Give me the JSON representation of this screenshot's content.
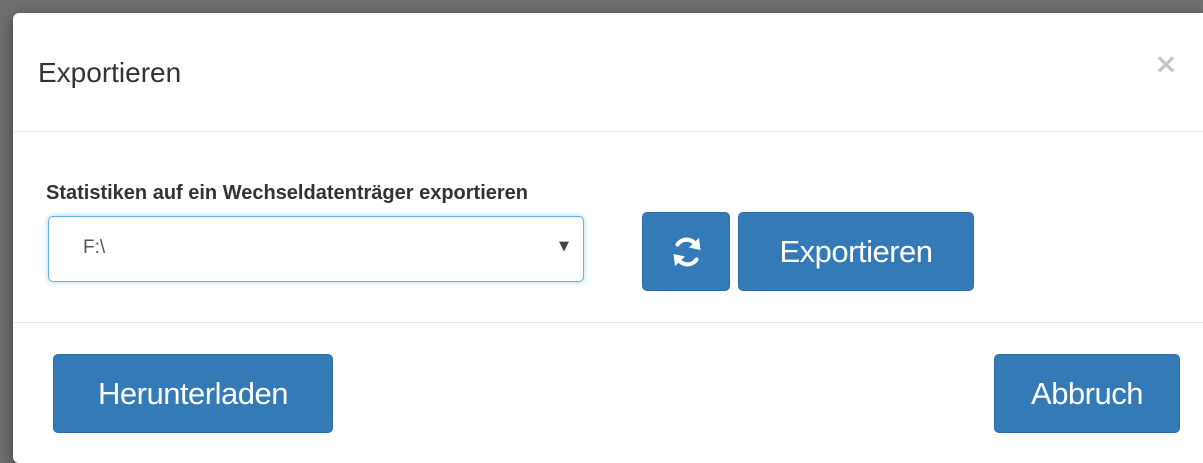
{
  "dialog": {
    "title": "Exportieren",
    "close_symbol": "×"
  },
  "export_section": {
    "label": "Statistiken auf ein Wechseldatenträger exportieren",
    "drive_select": {
      "selected_value": "F:\\",
      "arrow": "▼"
    },
    "refresh_icon": "refresh-icon",
    "export_label": "Exportieren"
  },
  "footer": {
    "download_label": "Herunterladen",
    "cancel_label": "Abbruch"
  },
  "colors": {
    "primary_button": "#337ab7",
    "focus_border": "#66afe9",
    "divider": "#e5e5e5"
  }
}
